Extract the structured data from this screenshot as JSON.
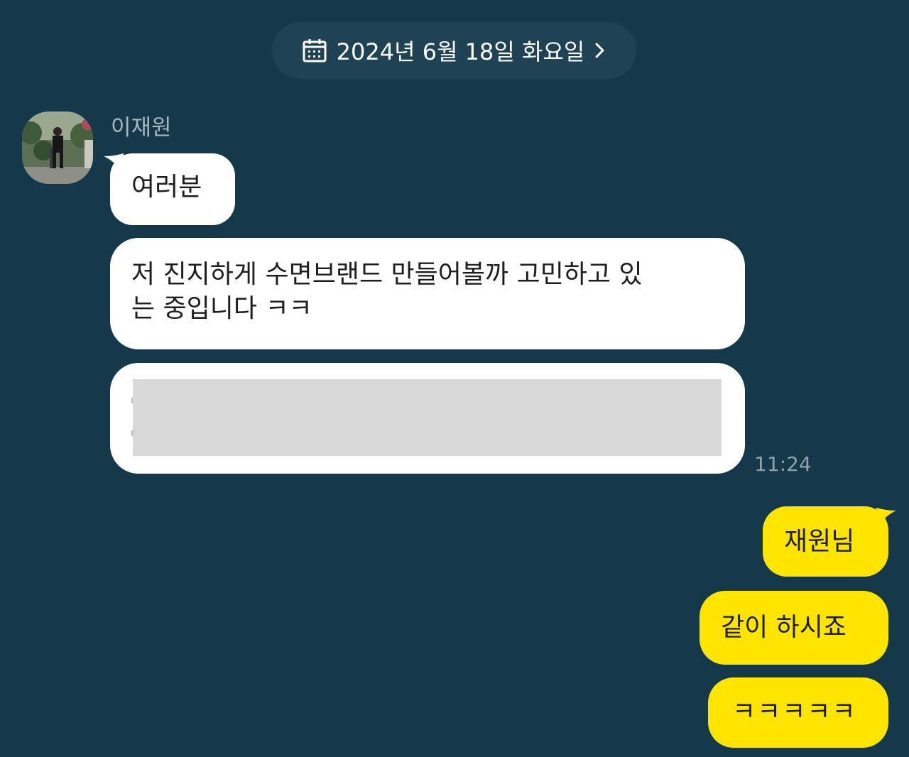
{
  "date_header": {
    "text": "2024년 6월 18일 화요일",
    "icons": [
      "calendar-icon",
      "chevron-right-icon"
    ]
  },
  "sender": {
    "name": "이재원",
    "avatar": "profile-photo"
  },
  "incoming_messages": [
    {
      "text": "여러분"
    },
    {
      "line1": "저 진지하게 수면브랜드 만들어볼까 고민하고 있",
      "line2": "는 중입니다 ㅋㅋ"
    },
    {
      "text": "",
      "redacted": true
    }
  ],
  "incoming_time": "11:24",
  "outgoing_messages": [
    {
      "text": "재원님"
    },
    {
      "text": "같이 하시죠"
    },
    {
      "text": "ㅋㅋㅋㅋㅋ"
    }
  ],
  "colors": {
    "background": "#15384b",
    "incoming_bubble": "#ffffff",
    "outgoing_bubble": "#fee500",
    "date_pill": "#1f4254"
  }
}
